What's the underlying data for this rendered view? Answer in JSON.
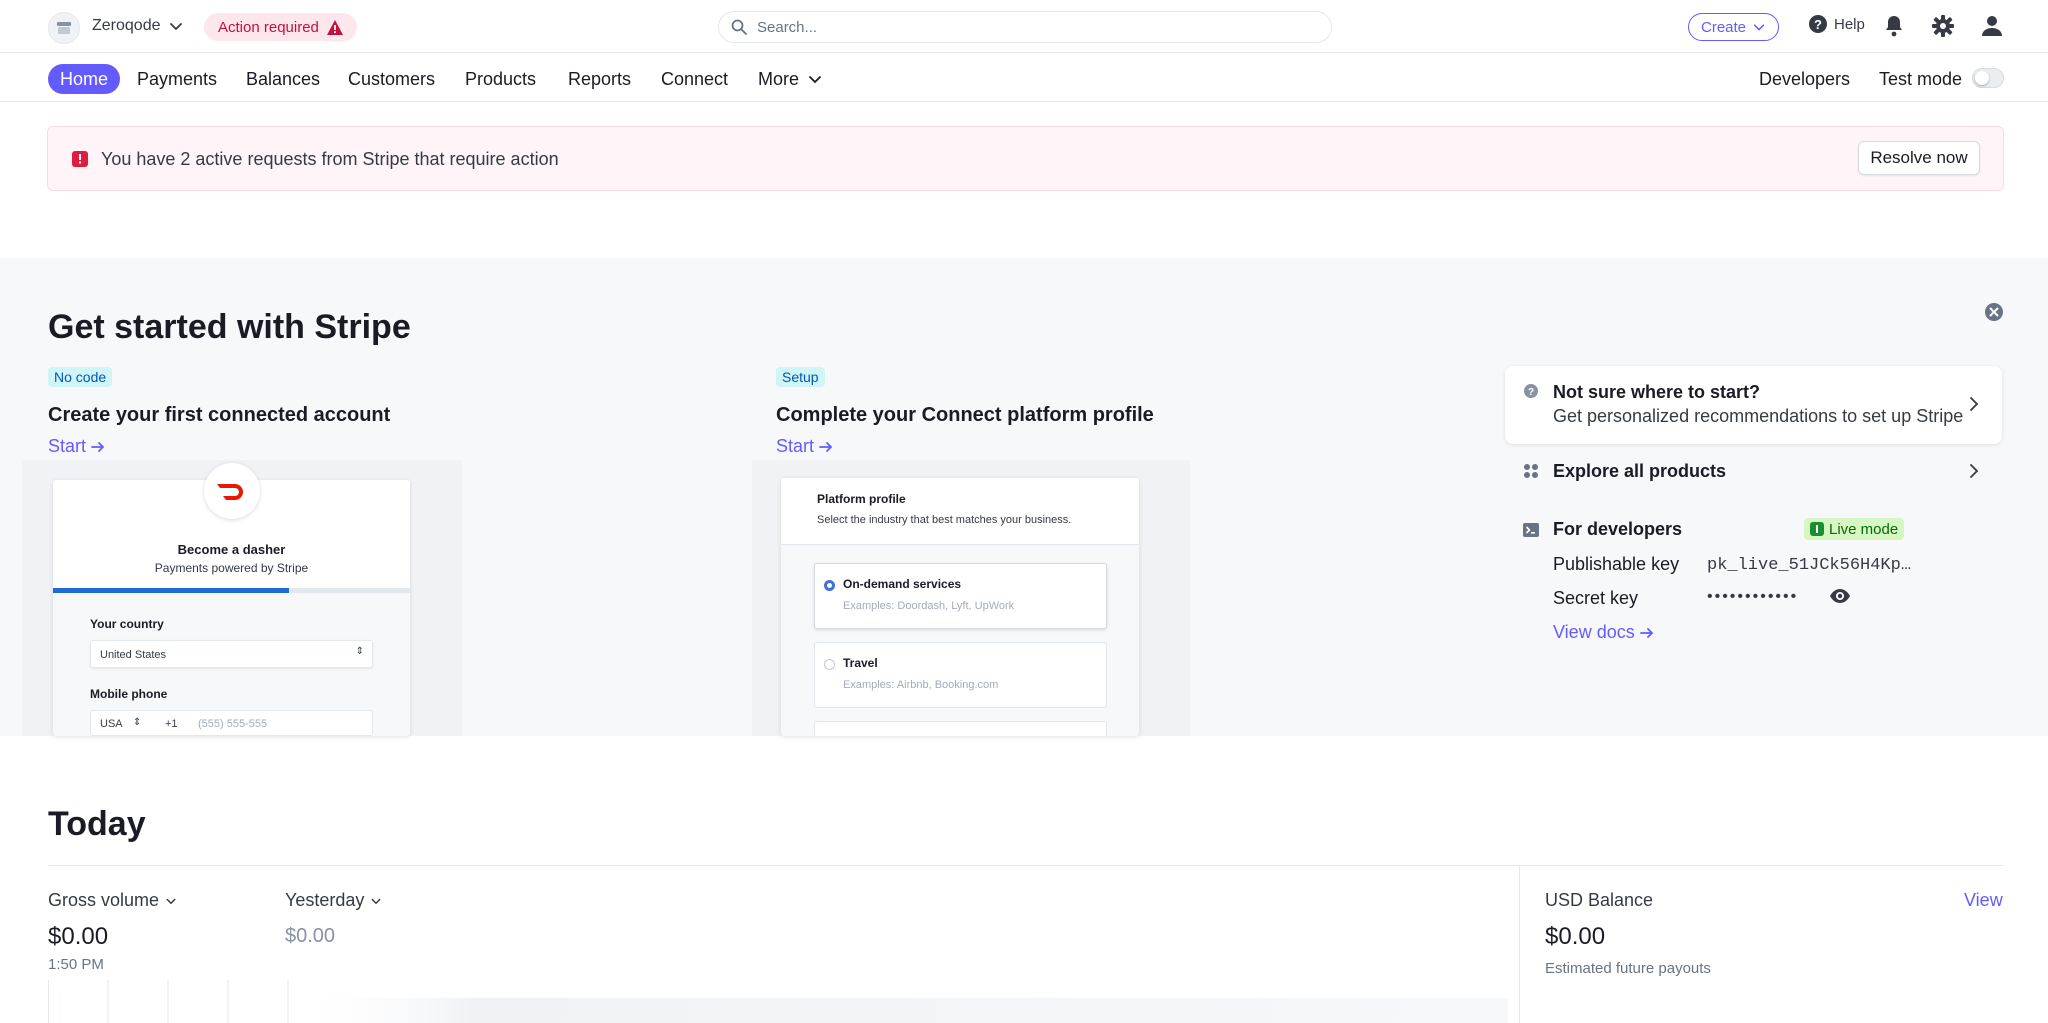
{
  "topbar": {
    "account_name": "Zeroqode",
    "action_required": "Action required",
    "search_placeholder": "Search...",
    "create_label": "Create",
    "help_label": "Help"
  },
  "nav": {
    "items": [
      "Home",
      "Payments",
      "Balances",
      "Customers",
      "Products",
      "Reports",
      "Connect",
      "More"
    ],
    "developers": "Developers",
    "test_mode": "Test mode"
  },
  "alert": {
    "text": "You have 2 active requests from Stripe that require action",
    "button": "Resolve now"
  },
  "get_started": {
    "title": "Get started with Stripe",
    "card1": {
      "badge": "No code",
      "title": "Create your first connected account",
      "link": "Start",
      "preview": {
        "heading": "Become a dasher",
        "powered": "Payments powered by Stripe",
        "country_label": "Your country",
        "country_value": "United States",
        "phone_label": "Mobile phone",
        "phone_country": "USA",
        "phone_code": "+1",
        "phone_placeholder": "(555) 555-555",
        "progress": 0.66
      }
    },
    "card2": {
      "badge": "Setup",
      "title": "Complete your Connect platform profile",
      "link": "Start",
      "preview": {
        "heading": "Platform profile",
        "sub": "Select the industry that best matches your business.",
        "option1_title": "On-demand services",
        "option1_ex": "Examples: Doordash, Lyft, UpWork",
        "option2_title": "Travel",
        "option2_ex": "Examples: Airbnb, Booking.com"
      }
    },
    "recommend": {
      "title": "Not sure where to start?",
      "sub": "Get personalized recommendations to set up Stripe"
    },
    "explore": "Explore all products",
    "developers": {
      "title": "For developers",
      "live_badge": "Live mode",
      "publishable_label": "Publishable key",
      "publishable_value": "pk_live_51JCk56H4Kp…",
      "secret_label": "Secret key",
      "secret_value": "••••••••••••",
      "docs_link": "View docs"
    }
  },
  "today": {
    "title": "Today",
    "gross_label": "Gross volume",
    "gross_value": "$0.00",
    "gross_time": "1:50 PM",
    "yesterday_label": "Yesterday",
    "yesterday_value": "$0.00",
    "balance_label": "USD Balance",
    "balance_value": "$0.00",
    "balance_sub": "Estimated future payouts",
    "view_link": "View"
  },
  "colors": {
    "accent": "#635bff",
    "alert": "#df1b41",
    "live_green": "#05690d"
  }
}
